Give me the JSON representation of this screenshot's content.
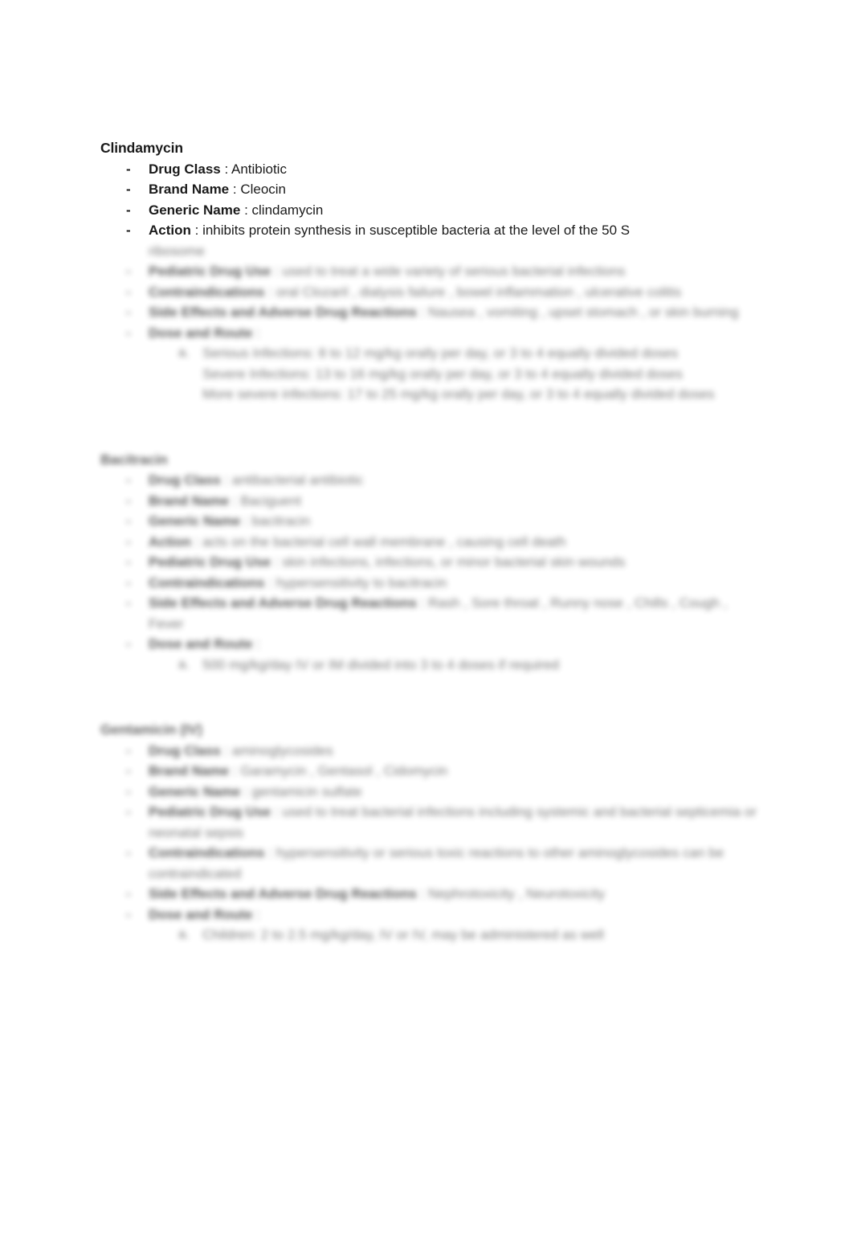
{
  "document": {
    "page_background": "#ffffff",
    "text_color": "#1a1a1a",
    "blur_color": "#6f6f6f"
  },
  "sections": [
    {
      "heading": "Clindamycin",
      "legible": true,
      "bullets": [
        {
          "marker": "-",
          "label": "Drug Class",
          "separator": " : ",
          "value": "Antibiotic",
          "legible": true
        },
        {
          "marker": "-",
          "label": "Brand Name",
          "separator": " : ",
          "value": "Cleocin",
          "legible": true
        },
        {
          "marker": "-",
          "label": "Generic Name",
          "separator": " : ",
          "value": "clindamycin",
          "legible": true
        },
        {
          "marker": "-",
          "label": "Action",
          "separator": " : ",
          "value": "inhibits protein synthesis in susceptible bacteria at the level of the 50 S",
          "legible": true,
          "continuation": "ribosome",
          "continuation_legible": false
        },
        {
          "marker": "-",
          "label": "Pediatric Drug Use",
          "separator": " : ",
          "value": "used to treat a wide variety of serious bacterial infections",
          "legible": false
        },
        {
          "marker": "-",
          "label": "Contraindications",
          "separator": " : ",
          "value": "oral Clozaril , dialysis failure , bowel inflammation , ulcerative colitis",
          "legible": false
        },
        {
          "marker": "-",
          "label": "Side Effects and Adverse Drug Reactions",
          "separator": " : ",
          "value": "Nausea , vomiting , upset stomach , or skin burning",
          "legible": false
        },
        {
          "marker": "-",
          "label": "Dose and Route",
          "separator": " :",
          "value": "",
          "legible": false
        }
      ],
      "subbullets": [
        {
          "marker": "a.",
          "text": "Serious Infections: 8 to 12 mg/kg orally per day, or 3 to 4 equally divided doses",
          "legible": false
        },
        {
          "marker": "",
          "text": "Severe Infections: 13 to 16 mg/kg orally per day, or 3 to 4 equally divided doses",
          "legible": false
        },
        {
          "marker": "",
          "text": "More severe infections: 17 to 25 mg/kg orally per day, or 3 to 4 equally divided doses",
          "legible": false
        }
      ]
    },
    {
      "heading": "Bacitracin",
      "legible": false,
      "bullets": [
        {
          "marker": "-",
          "label": "Drug Class",
          "separator": " : ",
          "value": "antibacterial antibiotic",
          "legible": false
        },
        {
          "marker": "-",
          "label": "Brand Name",
          "separator": " : ",
          "value": "Baciguent",
          "legible": false
        },
        {
          "marker": "-",
          "label": "Generic Name",
          "separator": " : ",
          "value": "bacitracin",
          "legible": false
        },
        {
          "marker": "-",
          "label": "Action",
          "separator": " : ",
          "value": "acts on the bacterial cell wall membrane , causing cell death",
          "legible": false
        },
        {
          "marker": "-",
          "label": "Pediatric Drug Use",
          "separator": " : ",
          "value": "skin infections, infections, or minor bacterial skin wounds",
          "legible": false
        },
        {
          "marker": "-",
          "label": "Contraindications",
          "separator": " : ",
          "value": "hypersensitivity to bacitracin",
          "legible": false
        },
        {
          "marker": "-",
          "label": "Side Effects and Adverse Drug Reactions",
          "separator": " : ",
          "value": "Rash , Sore throat , Runny nose , Chills , Cough , Fever",
          "legible": false
        },
        {
          "marker": "-",
          "label": "Dose and Route",
          "separator": " :",
          "value": "",
          "legible": false
        }
      ],
      "subbullets": [
        {
          "marker": "a.",
          "text": "500 mg/kg/day IV or IM divided into 3 to 4 doses if required",
          "legible": false
        }
      ]
    },
    {
      "heading": "Gentamicin (IV)",
      "legible": false,
      "bullets": [
        {
          "marker": "-",
          "label": "Drug Class",
          "separator": " : ",
          "value": "aminoglycosides",
          "legible": false
        },
        {
          "marker": "-",
          "label": "Brand Name",
          "separator": " : ",
          "value": "Garamycin , Gentasol , Cidomycin",
          "legible": false
        },
        {
          "marker": "-",
          "label": "Generic Name",
          "separator": " : ",
          "value": "gentamicin sulfate",
          "legible": false
        },
        {
          "marker": "-",
          "label": "Pediatric Drug Use",
          "separator": " : ",
          "value": "used to treat bacterial infections including systemic and bacterial septicemia or neonatal sepsis",
          "legible": false
        },
        {
          "marker": "-",
          "label": "Contraindications",
          "separator": " : ",
          "value": "hypersensitivity or serious toxic reactions to other aminoglycosides can be contraindicated",
          "legible": false
        },
        {
          "marker": "-",
          "label": "Side Effects and Adverse Drug Reactions",
          "separator": " : ",
          "value": "Nephrotoxicity , Neurotoxicity",
          "legible": false
        },
        {
          "marker": "-",
          "label": "Dose and Route",
          "separator": " :",
          "value": "",
          "legible": false
        }
      ],
      "subbullets": [
        {
          "marker": "a.",
          "text": "Children: 2 to 2.5 mg/kg/day, IV or IV, may be administered as well",
          "legible": false
        }
      ]
    }
  ]
}
